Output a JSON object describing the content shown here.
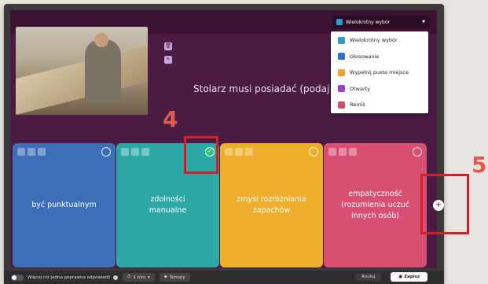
{
  "header": {
    "question_type_label": "Wielokrotny wybór",
    "question_type_icon": "multiple-choice-icon"
  },
  "question": {
    "text": "Stolarz musi posiadać (podaj no",
    "image_alt": "carpenter-photo"
  },
  "dropdown": {
    "items": [
      {
        "label": "Wielokrotny wybór",
        "color": "#2f9ccc"
      },
      {
        "label": "Głosowanie",
        "color": "#2f6fd1"
      },
      {
        "label": "Wypełnij puste miejsce",
        "color": "#f0a232"
      },
      {
        "label": "Otwarty",
        "color": "#9a41c9"
      },
      {
        "label": "Remis",
        "color": "#d9466b"
      }
    ]
  },
  "annotations": {
    "marker_4": "4",
    "marker_5": "5"
  },
  "answers": [
    {
      "text": "być punktualnym",
      "color": "#3c6fb8",
      "checked": false
    },
    {
      "text": "zdolności manualne",
      "color": "#2ea7a7",
      "checked": true
    },
    {
      "text": "zmysł rozróżniania zapachów",
      "color": "#efae2c",
      "checked": false
    },
    {
      "text": "empatyczność (rozumienia uczuć innych osób)",
      "color": "#d94f72",
      "checked": false
    }
  ],
  "footer": {
    "multiple_correct_label": "Więcej niż jedna poprawna odpowiedź",
    "time_label": "1 min",
    "topics_label": "Tematy",
    "cancel_label": "Anuluj",
    "save_label": "Zapisz"
  }
}
